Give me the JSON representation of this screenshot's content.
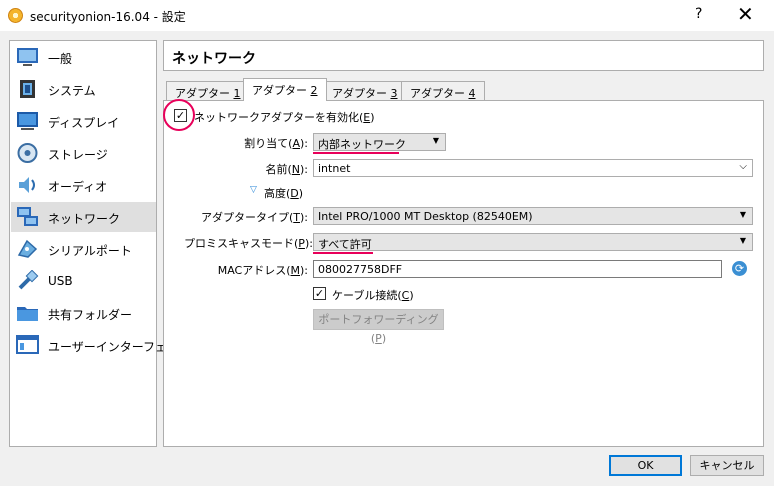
{
  "window": {
    "title": "securityonion-16.04 - 設定",
    "help": "?",
    "close": "✕"
  },
  "sidebar": {
    "items": [
      {
        "label": "一般",
        "icon": "general-icon"
      },
      {
        "label": "システム",
        "icon": "system-icon"
      },
      {
        "label": "ディスプレイ",
        "icon": "display-icon"
      },
      {
        "label": "ストレージ",
        "icon": "storage-icon"
      },
      {
        "label": "オーディオ",
        "icon": "audio-icon"
      },
      {
        "label": "ネットワーク",
        "icon": "network-icon",
        "selected": true
      },
      {
        "label": "シリアルポート",
        "icon": "serial-port-icon"
      },
      {
        "label": "USB",
        "icon": "usb-icon"
      },
      {
        "label": "共有フォルダー",
        "icon": "shared-folder-icon"
      },
      {
        "label": "ユーザーインターフェース",
        "icon": "user-interface-icon"
      }
    ]
  },
  "main": {
    "header": "ネットワーク",
    "tabs": [
      {
        "label": "アダプター ",
        "key": "1"
      },
      {
        "label": "アダプター ",
        "key": "2"
      },
      {
        "label": "アダプター ",
        "key": "3"
      },
      {
        "label": "アダプター ",
        "key": "4"
      }
    ],
    "active_tab": 1
  },
  "form": {
    "enable_adapter": {
      "label": "ネットワークアダプターを有効化(",
      "key": "E",
      "suffix": ")",
      "checked": true
    },
    "attached_to": {
      "label": "割り当て(",
      "key": "A",
      "suffix": "):",
      "value": "内部ネットワーク"
    },
    "name": {
      "label": "名前(",
      "key": "N",
      "suffix": "):",
      "value": "intnet"
    },
    "advanced": {
      "label": "高度(",
      "key": "D",
      "suffix": ")"
    },
    "adapter_type": {
      "label": "アダプタータイプ(",
      "key": "T",
      "suffix": "):",
      "value": "Intel PRO/1000 MT Desktop (82540EM)"
    },
    "promiscuous": {
      "label": "プロミスキャスモード(",
      "key": "P",
      "suffix": "):",
      "value": "すべて許可"
    },
    "mac": {
      "label": "MACアドレス(",
      "key": "M",
      "suffix": "):",
      "value": "080027758DFF"
    },
    "cable": {
      "label": "ケーブル接続(",
      "key": "C",
      "suffix": ")",
      "checked": true
    },
    "port_forwarding": {
      "label": "ポートフォワーディング(",
      "key": "P",
      "suffix": ")"
    }
  },
  "buttons": {
    "ok": "OK",
    "cancel": "キャンセル"
  },
  "glyphs": {
    "check": "✓",
    "dropdown": "▼",
    "chevron": "⌵",
    "expand": "▽",
    "refresh": "⟳"
  },
  "colors": {
    "highlight": "#e8005a",
    "accent": "#0078d7"
  }
}
